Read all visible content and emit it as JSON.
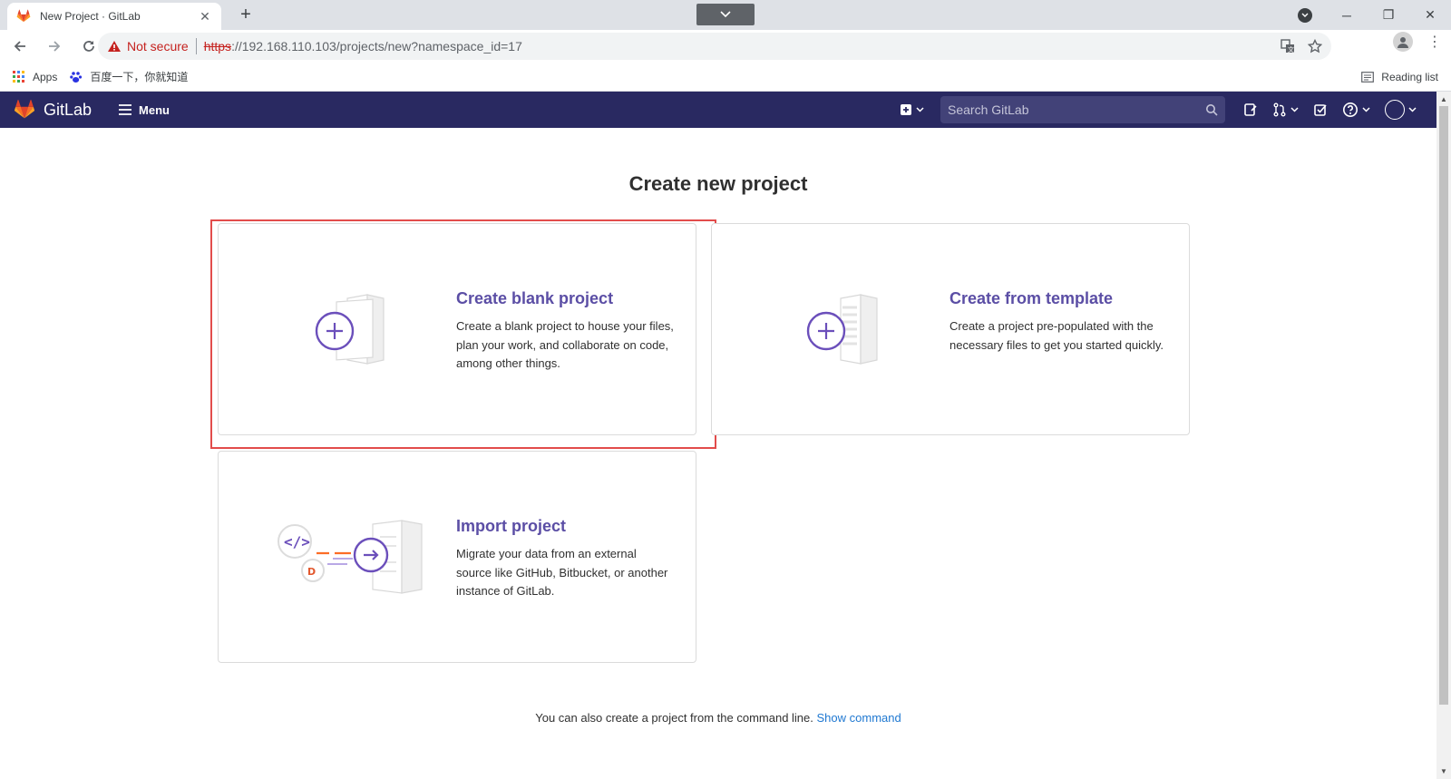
{
  "browser": {
    "tab_title": "New Project · GitLab",
    "not_secure_label": "Not secure",
    "url_scheme": "https",
    "url_rest": "://192.168.110.103/projects/new?namespace_id=17",
    "bookmarks": [
      {
        "label": "Apps",
        "icon": "apps-grid-icon"
      },
      {
        "label": "百度一下，你就知道",
        "icon": "baidu-paw-icon"
      }
    ],
    "reading_list_label": "Reading list"
  },
  "gitlab": {
    "brand": "GitLab",
    "menu_label": "Menu",
    "search_placeholder": "Search GitLab",
    "brand_color": "#292961"
  },
  "main": {
    "title": "Create new project",
    "cards": [
      {
        "title": "Create blank project",
        "description": "Create a blank project to house your files, plan your work, and collaborate on code, among other things."
      },
      {
        "title": "Create from template",
        "description": "Create a project pre-populated with the necessary files to get you started quickly."
      },
      {
        "title": "Import project",
        "description": "Migrate your data from an external source like GitHub, Bitbucket, or another instance of GitLab."
      }
    ],
    "cli_text": "You can also create a project from the command line.",
    "cli_link": "Show command"
  }
}
